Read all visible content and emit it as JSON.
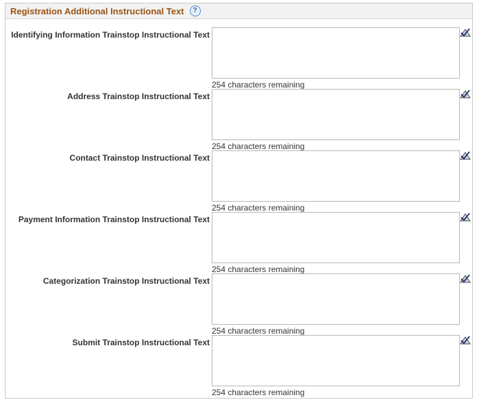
{
  "section": {
    "title": "Registration Additional Instructional Text",
    "help_icon_glyph": "?"
  },
  "fields": [
    {
      "label": "Identifying Information Trainstop Instructional Text",
      "value": "",
      "remaining": "254 characters remaining"
    },
    {
      "label": "Address Trainstop Instructional Text",
      "value": "",
      "remaining": "254 characters remaining"
    },
    {
      "label": "Contact Trainstop Instructional Text",
      "value": "",
      "remaining": "254 characters remaining"
    },
    {
      "label": "Payment Information Trainstop Instructional Text",
      "value": "",
      "remaining": "254 characters remaining"
    },
    {
      "label": "Categorization Trainstop Instructional Text",
      "value": "",
      "remaining": "254 characters remaining"
    },
    {
      "label": "Submit Trainstop Instructional Text",
      "value": "",
      "remaining": "254 characters remaining"
    }
  ],
  "icons": {
    "help": "help-icon",
    "spell_check": "spell-check-icon"
  },
  "colors": {
    "header_text": "#9a5412",
    "header_bg": "#f2f2f2",
    "border": "#c8c8c8"
  }
}
